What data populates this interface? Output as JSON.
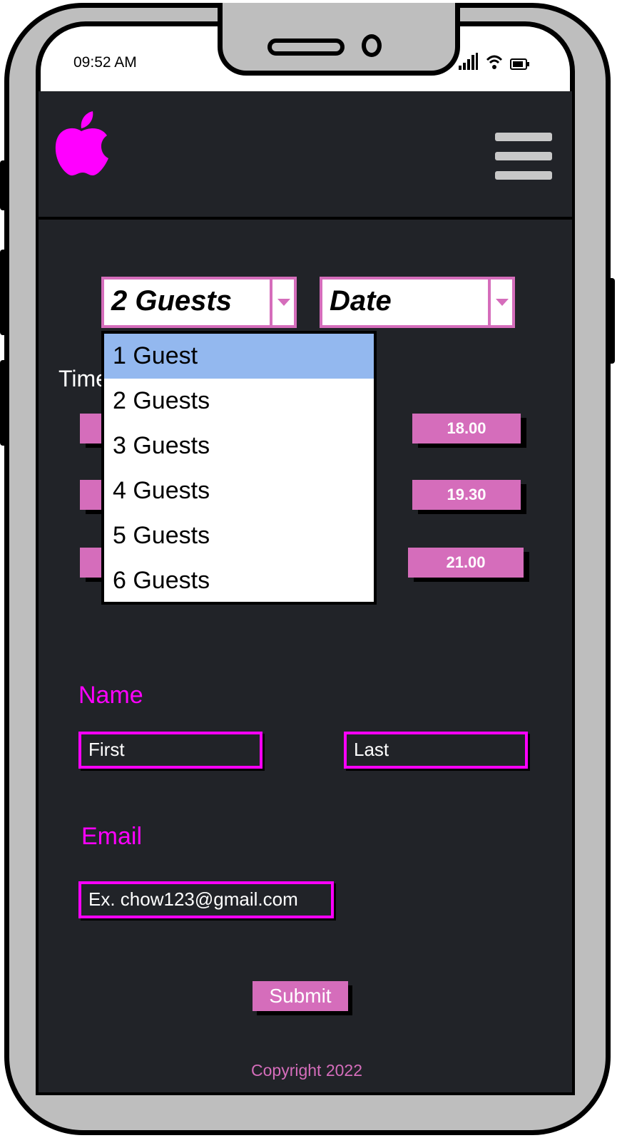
{
  "status_bar": {
    "time": "09:52 AM"
  },
  "header": {
    "logo": "apple-logo",
    "menu": "hamburger-menu-icon"
  },
  "guests_select": {
    "value": "2 Guests",
    "options": [
      "1 Guest",
      "2 Guests",
      "3 Guests",
      "4 Guests",
      "5 Guests",
      "6 Guests"
    ],
    "highlighted": "1 Guest"
  },
  "date_select": {
    "value": "Date"
  },
  "time_label": "Time",
  "time_slots": [
    "18.00",
    "19.30",
    "21.00"
  ],
  "name_label": "Name",
  "first_placeholder": "First",
  "last_placeholder": "Last",
  "email_label": "Email",
  "email_placeholder": "Ex. chow123@gmail.com",
  "submit_label": "Submit",
  "footer": "Copyright 2022",
  "colors": {
    "accent": "#d56dbb",
    "magenta": "#ff00ff",
    "bg": "#212328",
    "highlight": "#93b8ef"
  }
}
